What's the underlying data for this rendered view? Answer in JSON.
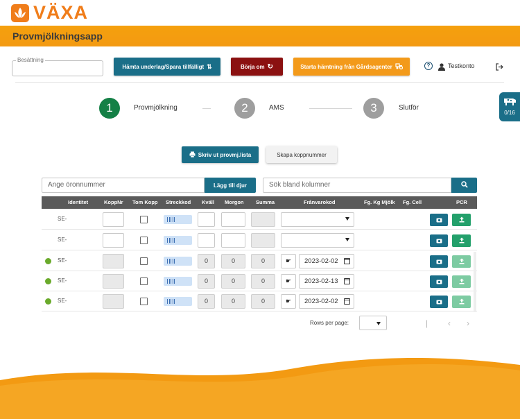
{
  "brand": {
    "name": "VÄXA",
    "color": "#f07d1a"
  },
  "app": {
    "title": "Provmjölkningsapp"
  },
  "toolbar": {
    "besattning_label": "Besättning",
    "besattning_value": "",
    "fetch_label": "Hämta underlag/Spara tillfälligt",
    "restart_label": "Börja om",
    "gardsagent_label": "Starta hämtning från Gårdsagenter",
    "user_name": "Testkonto"
  },
  "stepper": {
    "steps": [
      {
        "number": "1",
        "label": "Provmjölkning",
        "state": "done"
      },
      {
        "number": "2",
        "label": "AMS",
        "state": "todo"
      },
      {
        "number": "3",
        "label": "Slutför",
        "state": "todo"
      }
    ]
  },
  "side_badge": {
    "count": "0/16"
  },
  "actions": {
    "print_label": "Skriv ut provmj.lista",
    "create_label": "Skapa koppnummer"
  },
  "search": {
    "ear_placeholder": "Ange öronnummer",
    "add_animal_label": "Lägg till djur",
    "column_placeholder": "Sök bland kolumner"
  },
  "table": {
    "headers": [
      "Identitet",
      "KoppNr",
      "Tom Kopp",
      "Streckkod",
      "Kväll",
      "Morgon",
      "Summa",
      "Frånvarokod",
      "Fg. Kg Mjölk",
      "Fg. Cell",
      "PCR"
    ],
    "rows": [
      {
        "identity": "SE-",
        "status": "",
        "kvall": "",
        "morgon": "",
        "summa": "",
        "franvaro_type": "select",
        "date": ""
      },
      {
        "identity": "SE-",
        "status": "",
        "kvall": "",
        "morgon": "",
        "summa": "",
        "franvaro_type": "select",
        "date": ""
      },
      {
        "identity": "SE-",
        "status": "green",
        "kvall": "0",
        "morgon": "0",
        "summa": "0",
        "franvaro_type": "date",
        "date": "2023-02-02"
      },
      {
        "identity": "SE-",
        "status": "green",
        "kvall": "0",
        "morgon": "0",
        "summa": "0",
        "franvaro_type": "date",
        "date": "2023-02-13"
      },
      {
        "identity": "SE-",
        "status": "green",
        "kvall": "0",
        "morgon": "0",
        "summa": "0",
        "franvaro_type": "date",
        "date": "2023-02-02"
      }
    ]
  },
  "pagination": {
    "rows_per_page_label": "Rows per page:",
    "rows_per_page_value": ""
  }
}
